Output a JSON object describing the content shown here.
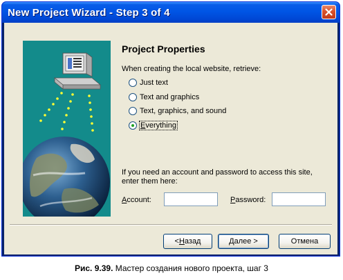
{
  "window": {
    "title": "New Project Wizard - Step 3 of 4"
  },
  "heading": "Project Properties",
  "prompt": "When creating the local website, retrieve:",
  "options": [
    {
      "label": "Just text",
      "underline": "",
      "rest": "Just text",
      "checked": false
    },
    {
      "label": "Text and graphics",
      "checked": false
    },
    {
      "label": "Text, graphics, and sound",
      "checked": false
    },
    {
      "label": "Everything",
      "first": "E",
      "rest": "verything",
      "checked": true
    }
  ],
  "account_info": "If you need an account and password to access this site, enter them here:",
  "account": {
    "label_first": "A",
    "label_rest": "ccount:",
    "value": ""
  },
  "password": {
    "label_first": "P",
    "label_rest": "assword:",
    "value": ""
  },
  "buttons": {
    "back_prefix": "< ",
    "back_first": "Н",
    "back_rest": "азад",
    "next_first": "Д",
    "next_rest": "алее >",
    "cancel": "Отмена"
  },
  "caption": {
    "bold": "Рис. 9.39.",
    "text": " Мастер создания нового проекта, шаг 3"
  },
  "colors": {
    "titlebar": "#0055e5",
    "art_background": "#138b8b",
    "face": "#ece9d8",
    "close": "#d9512b"
  }
}
